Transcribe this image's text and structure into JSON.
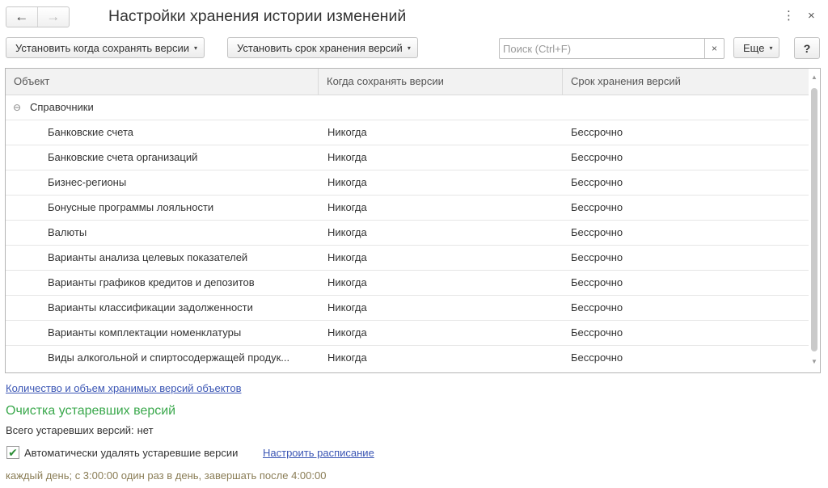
{
  "window": {
    "title": "Настройки хранения истории изменений",
    "back_icon": "←",
    "forward_icon": "→",
    "more_icon": "⋮",
    "close_icon": "×"
  },
  "toolbar": {
    "set_when_label": "Установить когда сохранять версии",
    "set_term_label": "Установить срок хранения версий",
    "search_placeholder": "Поиск (Ctrl+F)",
    "search_value": "",
    "search_clear": "×",
    "more_label": "Еще",
    "help_label": "?",
    "caret": "▾"
  },
  "table": {
    "columns": [
      "Объект",
      "Когда сохранять версии",
      "Срок хранения версий"
    ],
    "group": {
      "label": "Справочники",
      "icon": "⊖"
    },
    "rows": [
      {
        "object": "Банковские счета",
        "when": "Никогда",
        "term": "Бессрочно"
      },
      {
        "object": "Банковские счета организаций",
        "when": "Никогда",
        "term": "Бессрочно"
      },
      {
        "object": "Бизнес-регионы",
        "when": "Никогда",
        "term": "Бессрочно"
      },
      {
        "object": "Бонусные программы лояльности",
        "when": "Никогда",
        "term": "Бессрочно"
      },
      {
        "object": "Валюты",
        "when": "Никогда",
        "term": "Бессрочно"
      },
      {
        "object": "Варианты анализа целевых показателей",
        "when": "Никогда",
        "term": "Бессрочно"
      },
      {
        "object": "Варианты графиков кредитов и депозитов",
        "when": "Никогда",
        "term": "Бессрочно"
      },
      {
        "object": "Варианты классификации задолженности",
        "when": "Никогда",
        "term": "Бессрочно"
      },
      {
        "object": "Варианты комплектации номенклатуры",
        "when": "Никогда",
        "term": "Бессрочно"
      },
      {
        "object": "Виды алкогольной и спиртосодержащей продук...",
        "when": "Никогда",
        "term": "Бессрочно"
      }
    ],
    "scroll_up": "▲",
    "scroll_down": "▼"
  },
  "footer": {
    "versions_link": "Количество и объем хранимых версий объектов",
    "cleanup_title": "Очистка устаревших версий",
    "total_label": "Всего устаревших версий:",
    "total_value": "нет",
    "auto_delete_checked": true,
    "auto_delete_label": "Автоматически удалять устаревшие версии",
    "check_mark": "✔",
    "schedule_link": "Настроить расписание",
    "schedule_desc": "каждый день; с 3:00:00 один раз в день, завершать после 4:00:00"
  }
}
